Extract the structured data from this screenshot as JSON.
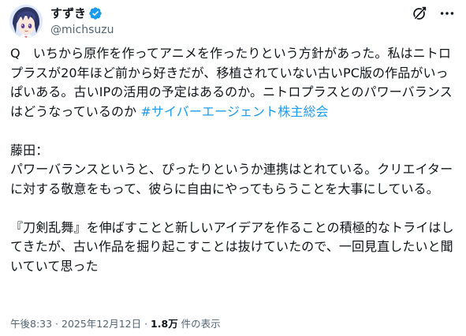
{
  "author": {
    "display_name": "すずき",
    "handle": "@michsuzu",
    "avatar_icon": "anime-character-avatar",
    "verified_icon": "verified-badge-icon",
    "verified_color": "#1d9bf0"
  },
  "header_actions": {
    "grok_icon": "grok-icon",
    "more_icon": "more-options-icon"
  },
  "tweet": {
    "question_text": "Q　いちから原作を作ってアニメを作ったりという方針があった。私はニトロプラスが20年ほど前から好きだが、移植されていない古いPC版の作品がいっぱいある。古いIPの活用の予定はあるのか。ニトロプラスとのパワーバランスはどうなっているのか ",
    "hashtag": "#サイバーエージェント株主総会",
    "answer_text": "\n\n藤田：\nパワーバランスというと、ぴったりというか連携はとれている。クリエイターに対する敬意をもって、彼らに自由にやってもらうことを大事にしている。\n\n『刀剣乱舞』を伸ばすことと新しいアイデアを作ることの積極的なトライはしてきたが、古い作品を掘り起こすことは抜けていたので、一回見直したいと聞いていて思った"
  },
  "meta": {
    "time": "午後8:33",
    "separator": " · ",
    "date": "2025年12月12日",
    "separator2": " · ",
    "views_count": "1.8万",
    "views_label": " 件の表示"
  },
  "colors": {
    "text": "#0f1419",
    "secondary": "#536471",
    "link": "#1d9bf0"
  }
}
